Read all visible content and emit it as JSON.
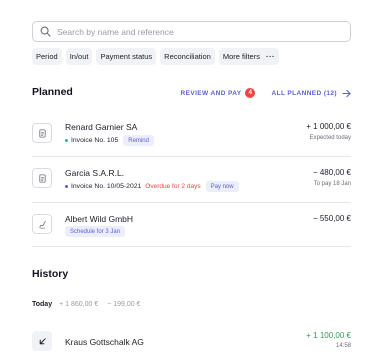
{
  "search": {
    "placeholder": "Search by name and reference",
    "value": ""
  },
  "filters": [
    {
      "label": "Period"
    },
    {
      "label": "In/out"
    },
    {
      "label": "Payment status"
    },
    {
      "label": "Reconciliation"
    },
    {
      "label": "More filters"
    }
  ],
  "planned": {
    "title": "Planned",
    "review_label": "REVIEW AND PAY",
    "review_count": "4",
    "all_label": "ALL PLANNED (12)",
    "items": [
      {
        "name": "Renard Garnier SA",
        "reference": "Invoice No. 105",
        "tag": "Remind",
        "amount": "+ 1 000,00 €",
        "meta": "Expected today",
        "icon": "document-icon"
      },
      {
        "name": "Garcia S.A.R.L.",
        "reference": "Invoice No. 10/05-2021",
        "status": "Overdue for 2 days",
        "tag": "Pay now",
        "amount": "− 480,00 €",
        "meta": "To pay 18 Jan",
        "icon": "document-icon"
      },
      {
        "name": "Albert Wild GmbH",
        "tag": "Schedule for 3 Jan",
        "amount": "− 550,00 €",
        "icon": "signature-icon"
      }
    ]
  },
  "history": {
    "title": "History",
    "today_label": "Today",
    "today_in": "+ 1 860,00 €",
    "today_out": "− 199,00 €",
    "items": [
      {
        "name": "Kraus Gottschalk AG",
        "amount": "+ 1 100,00 €",
        "time": "14:58",
        "icon": "arrow-down-left-icon"
      }
    ]
  },
  "colors": {
    "accent": "#5a5fd6",
    "danger": "#ef4444",
    "positive": "#2f9b58",
    "teal_dot": "#2db3a0"
  }
}
